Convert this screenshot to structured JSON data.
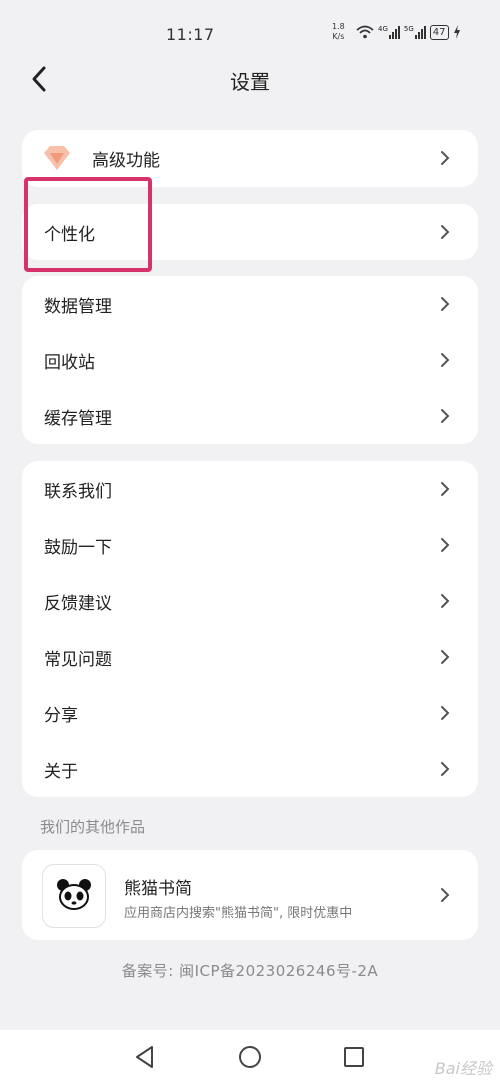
{
  "status_bar": {
    "time": "11:17",
    "net_speed_value": "1.8",
    "net_speed_unit": "K/s",
    "signal1_label": "4G",
    "signal2_label": "5G",
    "battery": "47"
  },
  "header": {
    "title": "设置"
  },
  "menu": {
    "premium": "高级功能",
    "personalize": "个性化",
    "data_group": [
      "数据管理",
      "回收站",
      "缓存管理"
    ],
    "support_group": [
      "联系我们",
      "鼓励一下",
      "反馈建议",
      "常见问题",
      "分享",
      "关于"
    ]
  },
  "other_works": {
    "section_title": "我们的其他作品",
    "app_name": "熊猫书简",
    "app_desc": "应用商店内搜索\"熊猫书简\", 限时优惠中"
  },
  "footer": {
    "icp": "备案号: 闽ICP备2023026246号-2A"
  },
  "watermark": "Bai经验",
  "colors": {
    "highlight": "#d6336c",
    "background": "#f1f1f3",
    "gem": "#f4a58a"
  }
}
